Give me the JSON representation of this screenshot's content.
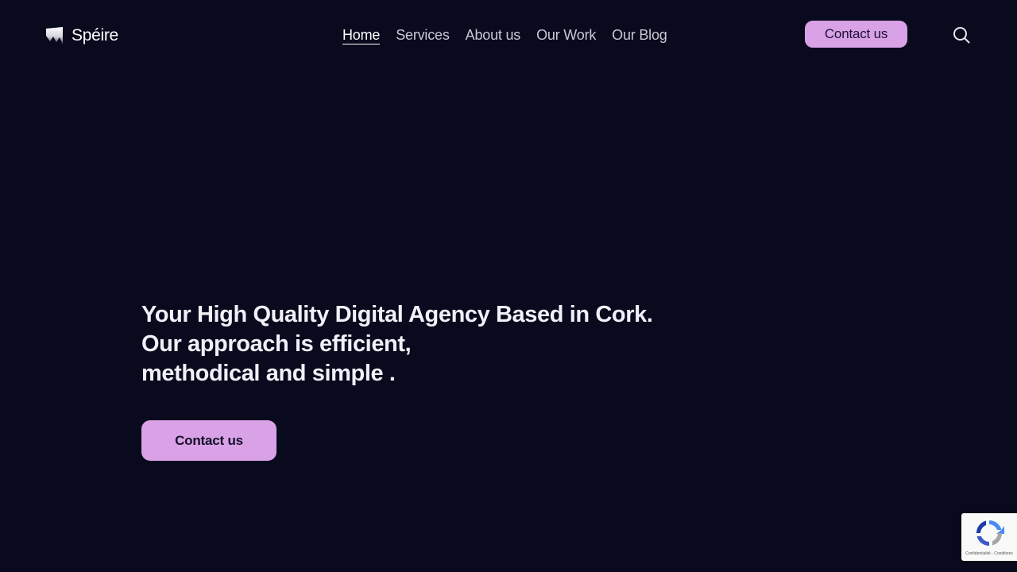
{
  "brand": {
    "name": "Spéire",
    "accent_color": "#d9a1e6",
    "background_color": "#0a0a1e"
  },
  "nav": {
    "items": [
      {
        "label": "Home",
        "active": true
      },
      {
        "label": "Services",
        "active": false
      },
      {
        "label": "About us",
        "active": false
      },
      {
        "label": "Our Work",
        "active": false
      },
      {
        "label": "Our Blog",
        "active": false
      }
    ]
  },
  "header": {
    "cta_label": "Contact us",
    "search_icon": "search-icon"
  },
  "hero": {
    "title_lines": [
      "Your High Quality Digital Agency Based in Cork.",
      "Our approach is efficient,",
      "methodical and simple ."
    ],
    "cta_label": "Contact us"
  },
  "recaptcha": {
    "links": "Confidentialité - Conditions",
    "icon": "recaptcha-icon"
  }
}
